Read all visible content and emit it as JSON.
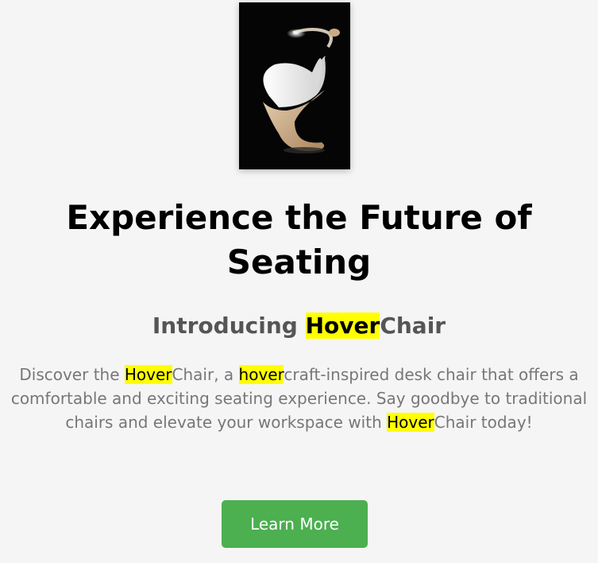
{
  "hero": {
    "image_subject": "white and wood hovercraft-style chair with curved lamp on black background"
  },
  "heading": {
    "line1": "Experience the Future of",
    "line2": "Seating"
  },
  "subheading": {
    "prefix": "Introducing ",
    "highlight": "Hover",
    "suffix": "Chair"
  },
  "description": {
    "part1": "Discover the ",
    "hl1": "Hover",
    "part2": "Chair, a ",
    "hl2": "hover",
    "part3": "craft-inspired desk chair that offers a comfortable and exciting seating experience. Say goodbye to traditional chairs and elevate your workspace with ",
    "hl3": "Hover",
    "part4": "Chair today!"
  },
  "cta": {
    "label": "Learn More"
  },
  "colors": {
    "background": "#f5f5f5",
    "highlight": "#ffff00",
    "button": "#4caf50",
    "heading": "#000000",
    "subheading": "#555555",
    "body_text": "#777777"
  }
}
